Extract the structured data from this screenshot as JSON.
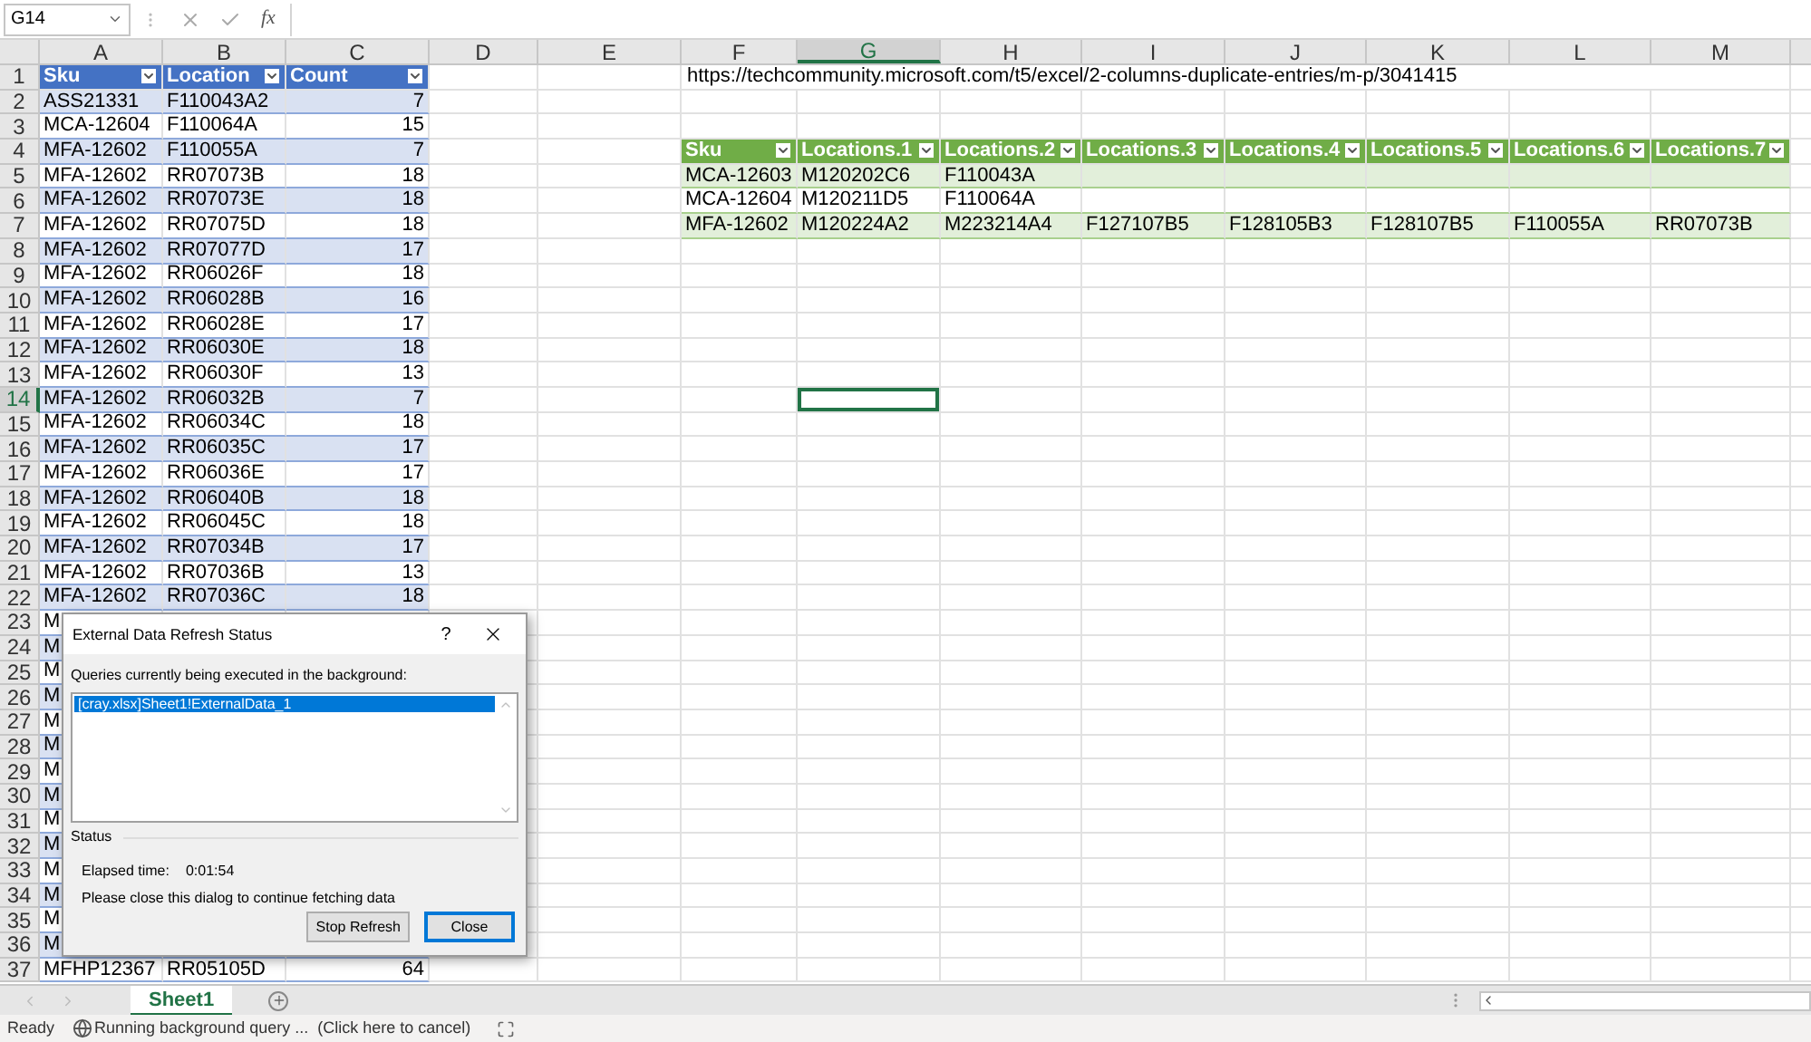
{
  "formula_bar": {
    "name_box": "G14",
    "function_label": "fx"
  },
  "columns": [
    {
      "label": "A",
      "selected": false
    },
    {
      "label": "B",
      "selected": false
    },
    {
      "label": "C",
      "selected": false
    },
    {
      "label": "D",
      "selected": false
    },
    {
      "label": "E",
      "selected": false
    },
    {
      "label": "F",
      "selected": false
    },
    {
      "label": "G",
      "selected": true
    },
    {
      "label": "H",
      "selected": false
    },
    {
      "label": "I",
      "selected": false
    },
    {
      "label": "J",
      "selected": false
    },
    {
      "label": "K",
      "selected": false
    },
    {
      "label": "L",
      "selected": false
    },
    {
      "label": "M",
      "selected": false
    }
  ],
  "row_numbers": [
    {
      "label": "1",
      "selected": false
    },
    {
      "label": "2",
      "selected": false
    },
    {
      "label": "3",
      "selected": false
    },
    {
      "label": "4",
      "selected": false
    },
    {
      "label": "5",
      "selected": false
    },
    {
      "label": "6",
      "selected": false
    },
    {
      "label": "7",
      "selected": false
    },
    {
      "label": "8",
      "selected": false
    },
    {
      "label": "9",
      "selected": false
    },
    {
      "label": "10",
      "selected": false
    },
    {
      "label": "11",
      "selected": false
    },
    {
      "label": "12",
      "selected": false
    },
    {
      "label": "13",
      "selected": false
    },
    {
      "label": "14",
      "selected": true
    },
    {
      "label": "15",
      "selected": false
    },
    {
      "label": "16",
      "selected": false
    },
    {
      "label": "17",
      "selected": false
    },
    {
      "label": "18",
      "selected": false
    },
    {
      "label": "19",
      "selected": false
    },
    {
      "label": "20",
      "selected": false
    },
    {
      "label": "21",
      "selected": false
    },
    {
      "label": "22",
      "selected": false
    },
    {
      "label": "23",
      "selected": false
    },
    {
      "label": "24",
      "selected": false
    },
    {
      "label": "25",
      "selected": false
    },
    {
      "label": "26",
      "selected": false
    },
    {
      "label": "27",
      "selected": false
    },
    {
      "label": "28",
      "selected": false
    },
    {
      "label": "29",
      "selected": false
    },
    {
      "label": "30",
      "selected": false
    },
    {
      "label": "31",
      "selected": false
    },
    {
      "label": "32",
      "selected": false
    },
    {
      "label": "33",
      "selected": false
    },
    {
      "label": "34",
      "selected": false
    },
    {
      "label": "35",
      "selected": false
    },
    {
      "label": "36",
      "selected": false
    },
    {
      "label": "37",
      "selected": false
    }
  ],
  "left_table": {
    "columns": [
      "Sku",
      "Location",
      "Count"
    ],
    "rows": [
      [
        "ASS21331",
        "F110043A2",
        "7"
      ],
      [
        "MCA-12604",
        "F110064A",
        "15"
      ],
      [
        "MFA-12602",
        "F110055A",
        "7"
      ],
      [
        "MFA-12602",
        "RR07073B",
        "18"
      ],
      [
        "MFA-12602",
        "RR07073E",
        "18"
      ],
      [
        "MFA-12602",
        "RR07075D",
        "18"
      ],
      [
        "MFA-12602",
        "RR07077D",
        "17"
      ],
      [
        "MFA-12602",
        "RR06026F",
        "18"
      ],
      [
        "MFA-12602",
        "RR06028B",
        "16"
      ],
      [
        "MFA-12602",
        "RR06028E",
        "17"
      ],
      [
        "MFA-12602",
        "RR06030E",
        "18"
      ],
      [
        "MFA-12602",
        "RR06030F",
        "13"
      ],
      [
        "MFA-12602",
        "RR06032B",
        "7"
      ],
      [
        "MFA-12602",
        "RR06034C",
        "18"
      ],
      [
        "MFA-12602",
        "RR06035C",
        "17"
      ],
      [
        "MFA-12602",
        "RR06036E",
        "17"
      ],
      [
        "MFA-12602",
        "RR06040B",
        "18"
      ],
      [
        "MFA-12602",
        "RR06045C",
        "18"
      ],
      [
        "MFA-12602",
        "RR07034B",
        "17"
      ],
      [
        "MFA-12602",
        "RR07036B",
        "13"
      ],
      [
        "MFA-12602",
        "RR07036C",
        "18"
      ],
      [
        "M"
      ],
      [
        "M"
      ],
      [
        "M"
      ],
      [
        "M"
      ],
      [
        "M"
      ],
      [
        "M"
      ],
      [
        "M"
      ],
      [
        "M"
      ],
      [
        "M"
      ],
      [
        "M"
      ],
      [
        "M"
      ],
      [
        "M"
      ],
      [
        "M"
      ],
      [
        "M"
      ],
      [
        "MFHP12367",
        "RR05105D",
        "64"
      ]
    ]
  },
  "url_text": "https://techcommunity.microsoft.com/t5/excel/2-columns-duplicate-entries/m-p/3041415",
  "right_table": {
    "columns": [
      "Sku",
      "Locations.1",
      "Locations.2",
      "Locations.3",
      "Locations.4",
      "Locations.5",
      "Locations.6",
      "Locations.7"
    ],
    "rows": [
      [
        "MCA-12603",
        "M120202C6",
        "F110043A"
      ],
      [
        "MCA-12604",
        "M120211D5",
        "F110064A"
      ],
      [
        "MFA-12602",
        "M120224A2",
        "M223214A4",
        "F127107B5",
        "F128105B3",
        "F128107B5",
        "F110055A",
        "RR07073B"
      ]
    ]
  },
  "dialog": {
    "title": "External Data Refresh Status",
    "help": "?",
    "list_label": "Queries currently being executed in the background:",
    "queries": [
      {
        "label": "[cray.xlsx]Sheet1!ExternalData_1",
        "selected": true
      }
    ],
    "status_heading": "Status",
    "elapsed_label": "Elapsed time:",
    "elapsed_value": "0:01:54",
    "message": "Please close this dialog to continue fetching data",
    "buttons": [
      {
        "label": "Stop Refresh",
        "default": false
      },
      {
        "label": "Close",
        "default": true
      }
    ]
  },
  "sheet_tabs": [
    {
      "label": "Sheet1",
      "selected": true
    }
  ],
  "status_bar": {
    "ready": "Ready",
    "query": "Running background query ...  (Click here to cancel)"
  }
}
